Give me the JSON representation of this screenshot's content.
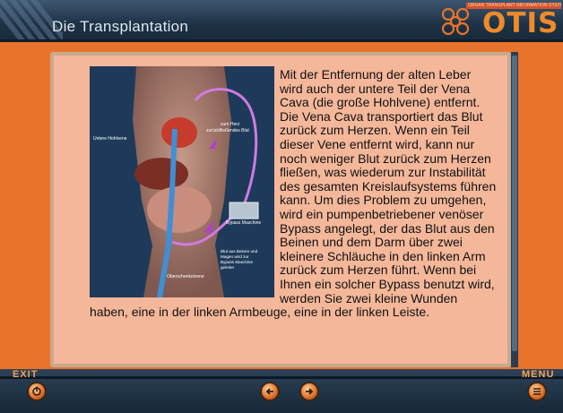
{
  "header": {
    "title": "Die Transplantation",
    "logo_text": "OTIS",
    "logo_tagline": "ORGAN TRANSPLANT INFORMATION SYSTEM"
  },
  "illustration": {
    "labels": {
      "untere_hohlvene": "Untere Hohlvene",
      "zum_herz": "zum Herz",
      "zurueckfliessendes_blut": "zurückfließendes Blut",
      "bypass_maschine": "Bypass Maschine",
      "blut_aus_beinen": "Blut aus Beinen und",
      "blut_aus_beinen_2": "Magen wird zur",
      "blut_aus_beinen_3": "Bypass Maschine",
      "blut_aus_beinen_4": "geleitet",
      "oberschenkelvene": "Oberschenkelvene"
    }
  },
  "article": {
    "text": "Mit der Entfernung der alten Leber wird auch der untere Teil der Vena Cava (die große Hohlvene) entfernt. Die Vena Cava transportiert das Blut zurück zum Herzen. Wenn ein Teil dieser Vene entfernt wird, kann nur noch weniger Blut zurück zum Herzen fließen, was wiederum zur Instabilität des gesamten Kreislaufsystems führen kann. Um dies Problem zu umgehen, wird ein pumpenbetriebener venöser Bypass angelegt, der das Blut aus den Beinen und dem Darm über zwei kleinere Schläuche in den linken Arm zurück zum Herzen führt. Wenn bei Ihnen ein solcher Bypass benutzt wird, werden Sie zwei kleine Wunden haben, eine in der linken Armbeuge, eine in der linken Leiste."
  },
  "footer": {
    "exit_label": "EXIT",
    "menu_label": "MENU"
  },
  "colors": {
    "background": "#e8732a",
    "content": "#f4b79a",
    "header": "#1f3347",
    "logo": "#f08a2a"
  }
}
